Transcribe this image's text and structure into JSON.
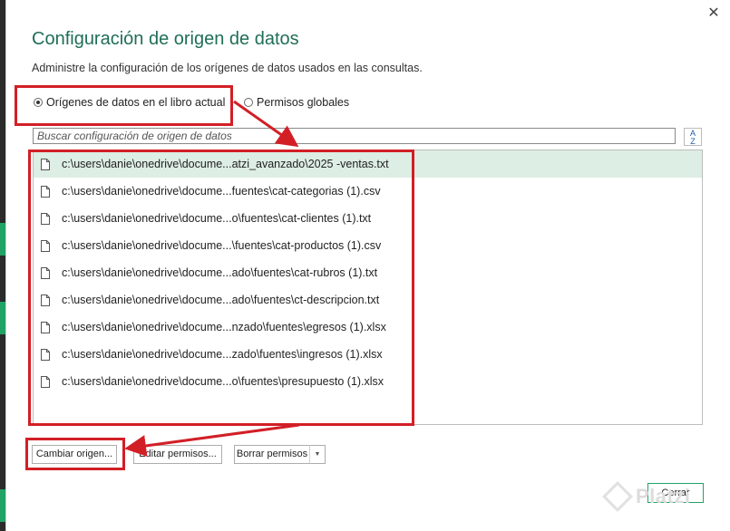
{
  "dialog": {
    "title": "Configuración de origen de datos",
    "subtitle": "Administre la configuración de los orígenes de datos usados en las consultas.",
    "close_glyph": "✕"
  },
  "scope": {
    "current_workbook_label": "Orígenes de datos en el libro actual",
    "global_permissions_label": "Permisos globales",
    "selected": "current_workbook"
  },
  "search": {
    "placeholder": "Buscar configuración de origen de datos",
    "sort_glyph_top": "A",
    "sort_glyph_bottom": "Z"
  },
  "sources": [
    {
      "path": "c:\\users\\danie\\onedrive\\docume...atzi_avanzado\\2025 -ventas.txt",
      "selected": true
    },
    {
      "path": "c:\\users\\danie\\onedrive\\docume...fuentes\\cat-categorias (1).csv",
      "selected": false
    },
    {
      "path": "c:\\users\\danie\\onedrive\\docume...o\\fuentes\\cat-clientes (1).txt",
      "selected": false
    },
    {
      "path": "c:\\users\\danie\\onedrive\\docume...\\fuentes\\cat-productos (1).csv",
      "selected": false
    },
    {
      "path": "c:\\users\\danie\\onedrive\\docume...ado\\fuentes\\cat-rubros (1).txt",
      "selected": false
    },
    {
      "path": "c:\\users\\danie\\onedrive\\docume...ado\\fuentes\\ct-descripcion.txt",
      "selected": false
    },
    {
      "path": "c:\\users\\danie\\onedrive\\docume...nzado\\fuentes\\egresos (1).xlsx",
      "selected": false
    },
    {
      "path": "c:\\users\\danie\\onedrive\\docume...zado\\fuentes\\ingresos (1).xlsx",
      "selected": false
    },
    {
      "path": "c:\\users\\danie\\onedrive\\docume...o\\fuentes\\presupuesto (1).xlsx",
      "selected": false
    }
  ],
  "actions": {
    "change_source": "Cambiar origen...",
    "edit_permissions": "Editar permisos...",
    "clear_permissions": "Borrar permisos",
    "clear_dropdown_glyph": "▼",
    "close": "Cerrar"
  },
  "watermark": "Platzi",
  "colors": {
    "accent_green": "#21a366",
    "title_green": "#1f6e57",
    "selection_bg": "#ddeee4",
    "annotation_red": "#d21f26"
  }
}
